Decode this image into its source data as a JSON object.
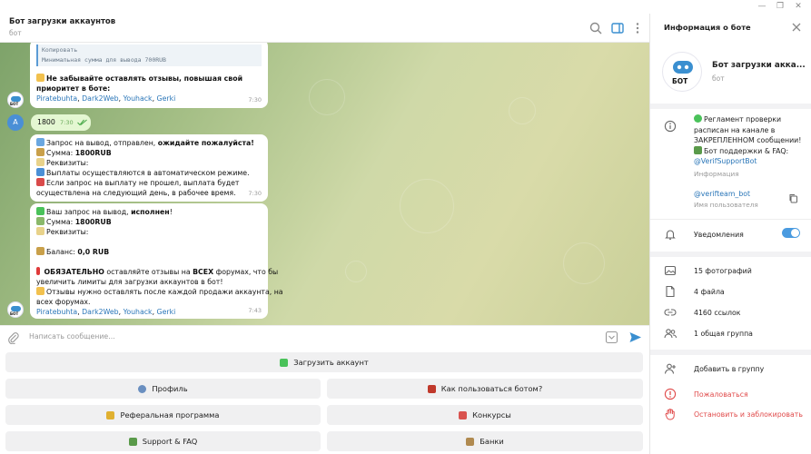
{
  "chat": {
    "title": "Бот загрузки аккаунтов",
    "subtitle": "бот"
  },
  "messages": {
    "m1": {
      "copy": "Копировать",
      "min_sum": "Минимальная сумма для вывода 700RUB",
      "l1": "Не забывайте оставлять отзывы, повышая свой",
      "l2": "приоритет в боте:",
      "links": [
        "Piratebuhta",
        "Dark2Web",
        "Youhack",
        "Gerki"
      ],
      "time": "7:30"
    },
    "user": {
      "avatar": "A",
      "text": "1800",
      "time": "7:30"
    },
    "m2": {
      "l1_a": "Запрос на вывод, отправлен,",
      "l1_b": "ожидайте пожалуйста!",
      "l2_a": "Сумма:",
      "l2_b": "1800RUB",
      "l3": "Реквизиты:",
      "l4": "Выплаты осуществляются в автоматическом режиме.",
      "l5": "Если запрос на выплату не прошел, выплата будет",
      "l6": "осуществлена на следующий день, в рабочее время.",
      "time": "7:30"
    },
    "m3": {
      "l1_a": "Ваш запрос на вывод,",
      "l1_b": "исполнен",
      "l1_c": "!",
      "l2_a": "Сумма:",
      "l2_b": "1800RUB",
      "l3": "Реквизиты:",
      "l4_a": "Баланс:",
      "l4_b": "0,0 RUB",
      "l5_a": "ОБЯЗАТЕЛЬНО",
      "l5_b": "оставляйте отзывы на",
      "l5_c": "ВСЕХ",
      "l5_d": "форумах, что бы",
      "l6": "увеличить лимиты для загрузки аккаунтов в бот!",
      "l7": "Отзывы нужно оставлять после каждой продажи аккаунта, на",
      "l8": "всех форумах.",
      "links": [
        "Piratebuhta",
        "Dark2Web",
        "Youhack",
        "Gerki"
      ],
      "time": "7:43"
    }
  },
  "input": {
    "placeholder": "Написать сообщение..."
  },
  "keyboard": {
    "upload": "Загрузить аккаунт",
    "profile": "Профиль",
    "howto": "Как пользоваться ботом?",
    "referral": "Реферальная программа",
    "contests": "Конкурсы",
    "support": "Support & FAQ",
    "banks": "Банки"
  },
  "panel": {
    "title": "Информация о боте",
    "avatar_text": "БОТ",
    "name": "Бот загрузки акка...",
    "name_sub": "бот",
    "info_l1": "Регламент проверки",
    "info_l2": "расписан на канале в",
    "info_l3": "ЗАКРЕПЛЕННОМ сообщении!",
    "info_l4": "Бот поддержки & FAQ:",
    "info_link": "@VerifSupportBot",
    "info_label": "Информация",
    "username": "@verifteam_bot",
    "username_label": "Имя пользователя",
    "notifications": "Уведомления",
    "photos": "15 фотографий",
    "files": "4 файла",
    "links": "4160 ссылок",
    "groups": "1 общая группа",
    "add_group": "Добавить в группу",
    "report": "Пожаловаться",
    "block": "Остановить и заблокировать"
  },
  "colors": {
    "accent": "#2a76b8",
    "danger": "#e04a4a",
    "toggle": "#4a9be0"
  }
}
